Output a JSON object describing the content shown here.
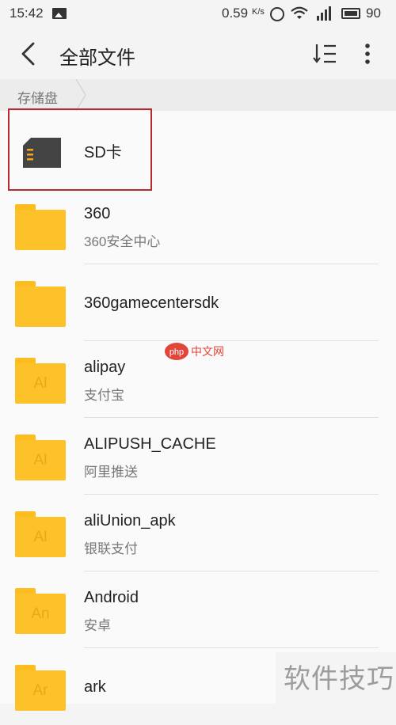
{
  "status_bar": {
    "time": "15:42",
    "net_speed": "0.59",
    "net_unit": "K/s",
    "battery": "90"
  },
  "app_bar": {
    "title": "全部文件",
    "back_icon": "chevron-left-icon",
    "sort_icon": "sort-list-icon",
    "more_icon": "more-vertical-icon"
  },
  "breadcrumb": {
    "items": [
      "存储盘"
    ]
  },
  "files": [
    {
      "name": "SD卡",
      "subtitle": "",
      "icon": "sd-card-icon",
      "icon_label": ""
    },
    {
      "name": "360",
      "subtitle": "360安全中心",
      "icon": "folder-icon",
      "icon_label": ""
    },
    {
      "name": "360gamecentersdk",
      "subtitle": "",
      "icon": "folder-icon",
      "icon_label": ""
    },
    {
      "name": "alipay",
      "subtitle": "支付宝",
      "icon": "folder-icon",
      "icon_label": "Al"
    },
    {
      "name": "ALIPUSH_CACHE",
      "subtitle": "阿里推送",
      "icon": "folder-icon",
      "icon_label": "Al"
    },
    {
      "name": "aliUnion_apk",
      "subtitle": "银联支付",
      "icon": "folder-icon",
      "icon_label": "Al"
    },
    {
      "name": "Android",
      "subtitle": "安卓",
      "icon": "folder-icon",
      "icon_label": "An"
    },
    {
      "name": "ark",
      "subtitle": "",
      "icon": "folder-icon",
      "icon_label": "Ar"
    }
  ],
  "watermarks": {
    "center_logo_text": "中文网",
    "center_logo_prefix": "php",
    "corner_text": "软件技巧"
  },
  "colors": {
    "folder": "#fdc22a",
    "selection_border": "#b52b2e",
    "background": "#fafafa"
  }
}
